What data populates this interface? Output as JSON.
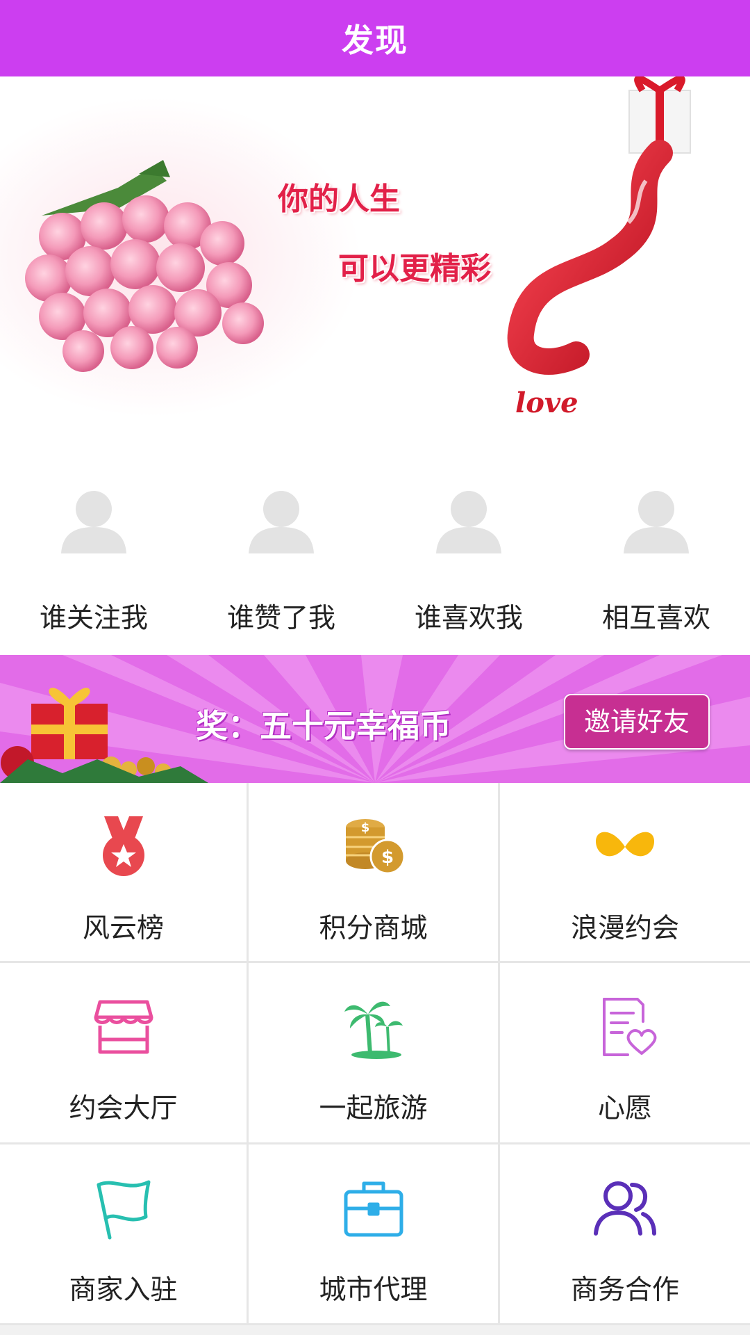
{
  "header": {
    "title": "发现"
  },
  "banner": {
    "slogan_line1": "你的人生",
    "slogan_line2": "可以更精彩",
    "love_text": "love"
  },
  "interactions": [
    {
      "label": "谁关注我",
      "icon": "avatar-icon"
    },
    {
      "label": "谁赞了我",
      "icon": "avatar-icon"
    },
    {
      "label": "谁喜欢我",
      "icon": "avatar-icon"
    },
    {
      "label": "相互喜欢",
      "icon": "avatar-icon"
    }
  ],
  "promo": {
    "reward_text": "奖：五十元幸福币",
    "invite_button": "邀请好友"
  },
  "grid": [
    {
      "label": "风云榜",
      "icon": "medal-icon",
      "color": "#e8484f"
    },
    {
      "label": "积分商城",
      "icon": "coins-icon",
      "color": "#d39a2e"
    },
    {
      "label": "浪漫约会",
      "icon": "bow-icon",
      "color": "#f8b70c"
    },
    {
      "label": "约会大厅",
      "icon": "storefront-icon",
      "color": "#ea4f9e"
    },
    {
      "label": "一起旅游",
      "icon": "palm-tree-icon",
      "color": "#3dba6f"
    },
    {
      "label": "心愿",
      "icon": "wish-list-icon",
      "color": "#c764d9"
    },
    {
      "label": "商家入驻",
      "icon": "flag-icon",
      "color": "#27bfb0"
    },
    {
      "label": "城市代理",
      "icon": "briefcase-icon",
      "color": "#2eaee8"
    },
    {
      "label": "商务合作",
      "icon": "people-icon",
      "color": "#5a2fb8"
    }
  ],
  "colors": {
    "header_bg": "#cc3ef0",
    "promo_bg": "#e26ce8",
    "invite_bg": "#c72f92"
  }
}
